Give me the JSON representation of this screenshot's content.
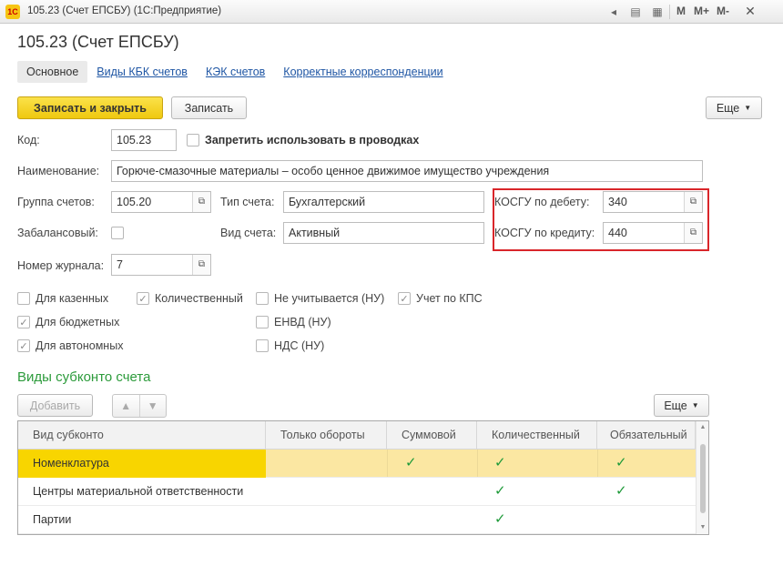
{
  "window": {
    "logo": "1С",
    "title": "105.23 (Счет ЕПСБУ)  (1С:Предприятие)",
    "m_buttons": [
      "M",
      "M+",
      "M-"
    ],
    "close": "✕"
  },
  "form": {
    "title": "105.23 (Счет ЕПСБУ)"
  },
  "tabs": [
    {
      "label": "Основное",
      "active": true
    },
    {
      "label": "Виды КБК счетов"
    },
    {
      "label": "КЭК счетов"
    },
    {
      "label": "Корректные корреспонденции"
    }
  ],
  "toolbar": {
    "save_close": "Записать и закрыть",
    "save": "Записать",
    "more": "Еще"
  },
  "fields": {
    "code_label": "Код:",
    "code": "105.23",
    "forbid_label": "Запретить использовать в проводках",
    "name_label": "Наименование:",
    "name": "Горюче-смазочные материалы – особо ценное движимое имущество учреждения",
    "group_label": "Группа счетов:",
    "group": "105.20",
    "type_label": "Тип счета:",
    "type": "Бухгалтерский",
    "kosgu_debit_label": "КОСГУ по дебету:",
    "kosgu_debit": "340",
    "offbalance_label": "Забалансовый:",
    "kind_label": "Вид счета:",
    "kind": "Активный",
    "kosgu_credit_label": "КОСГУ по кредиту:",
    "kosgu_credit": "440",
    "journal_label": "Номер журнала:",
    "journal": "7"
  },
  "checkboxes": [
    {
      "label": "Для казенных",
      "checked": false
    },
    {
      "label": "Количественный",
      "checked": true
    },
    {
      "label": "Не учитывается (НУ)",
      "checked": false
    },
    {
      "label": "Учет по КПС",
      "checked": true
    },
    {
      "label": "Для бюджетных",
      "checked": true
    },
    {
      "label": "ЕНВД (НУ)",
      "checked": false
    },
    {
      "label": "Для автономных",
      "checked": true
    },
    {
      "label": "НДС (НУ)",
      "checked": false
    }
  ],
  "subconto": {
    "title": "Виды субконто счета",
    "add": "Добавить",
    "more": "Еще",
    "columns": [
      "Вид субконто",
      "Только обороты",
      "Суммовой",
      "Количественный",
      "Обязательный"
    ],
    "rows": [
      {
        "name": "Номенклатура",
        "turnover": false,
        "sum": true,
        "qty": true,
        "required": true,
        "selected": true
      },
      {
        "name": "Центры материальной ответственности",
        "turnover": false,
        "sum": false,
        "qty": true,
        "required": true
      },
      {
        "name": "Партии",
        "turnover": false,
        "sum": false,
        "qty": true,
        "required": false
      }
    ]
  },
  "colors": {
    "accent": "#f8d500",
    "link": "#1f56a4",
    "section": "#2c9b3b",
    "highlight": "#d9262a",
    "check": "#1e9a39"
  }
}
